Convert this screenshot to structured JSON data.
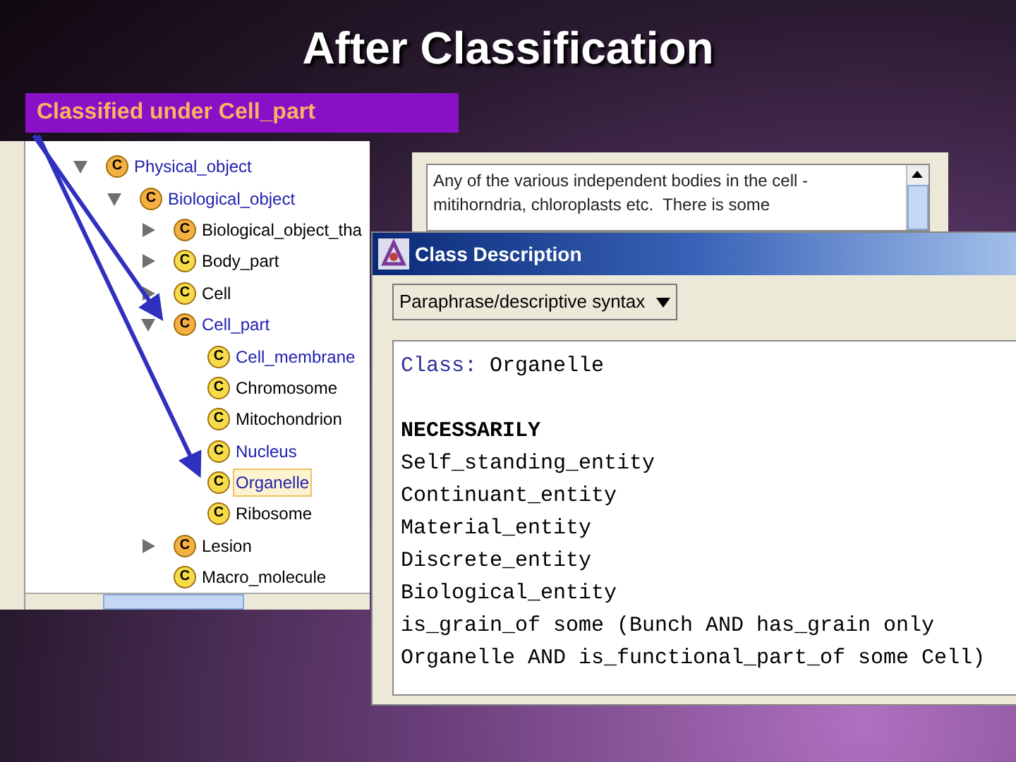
{
  "slide_title": "After Classification",
  "callout": "Classified under Cell_part",
  "tree": [
    {
      "icon": "C",
      "label": "Physical_object",
      "color": "#f5b041",
      "kind": "linked",
      "expanded": true,
      "selected": false,
      "children": [
        {
          "icon": "C",
          "label": "Biological_object",
          "color": "#f5b041",
          "kind": "linked",
          "expanded": true,
          "selected": false,
          "children": [
            {
              "icon": "C",
              "label": "Biological_object_tha",
              "color": "#f5b041",
              "kind": "plain",
              "expanded": false,
              "selected": false
            },
            {
              "icon": "C",
              "label": "Body_part",
              "color": "#f7dc4a",
              "kind": "plain",
              "expanded": false,
              "selected": false
            },
            {
              "icon": "C",
              "label": "Cell",
              "color": "#f7dc4a",
              "kind": "plain",
              "expanded": false,
              "selected": false
            },
            {
              "icon": "C",
              "label": "Cell_part",
              "color": "#f5b041",
              "kind": "linked",
              "expanded": true,
              "selected": false,
              "children": [
                {
                  "icon": "C",
                  "label": "Cell_membrane",
                  "color": "#f7dc4a",
                  "kind": "linked",
                  "selected": false
                },
                {
                  "icon": "C",
                  "label": "Chromosome",
                  "color": "#f7dc4a",
                  "kind": "plain",
                  "selected": false
                },
                {
                  "icon": "C",
                  "label": "Mitochondrion",
                  "color": "#f7dc4a",
                  "kind": "plain",
                  "selected": false
                },
                {
                  "icon": "C",
                  "label": "Nucleus",
                  "color": "#f7dc4a",
                  "kind": "linked",
                  "selected": false
                },
                {
                  "icon": "C",
                  "label": "Organelle",
                  "color": "#f7dc4a",
                  "kind": "linked",
                  "selected": true
                },
                {
                  "icon": "C",
                  "label": "Ribosome",
                  "color": "#f7dc4a",
                  "kind": "plain",
                  "selected": false
                }
              ]
            },
            {
              "icon": "C",
              "label": "Lesion",
              "color": "#f5b041",
              "kind": "plain",
              "expanded": false,
              "selected": false
            },
            {
              "icon": "C",
              "label": "Macro_molecule",
              "color": "#f7dc4a",
              "kind": "plain",
              "selected": false
            }
          ]
        }
      ]
    }
  ],
  "comment_lines": [
    "Any of the various independent bodies in the cell -",
    "mitihorndria, chloroplasts etc.  There is some"
  ],
  "class_description": {
    "title": "Class Description",
    "syntax_dropdown": "Paraphrase/descriptive syntax",
    "class_keyword": "Class:",
    "class_name": "Organelle",
    "heading": "NECESSARILY",
    "lines": [
      "Self_standing_entity",
      "Continuant_entity",
      "Material_entity",
      "Discrete_entity",
      "Biological_entity",
      "is_grain_of some (Bunch AND has_grain only",
      "Organelle AND is_functional_part_of some Cell)"
    ]
  }
}
